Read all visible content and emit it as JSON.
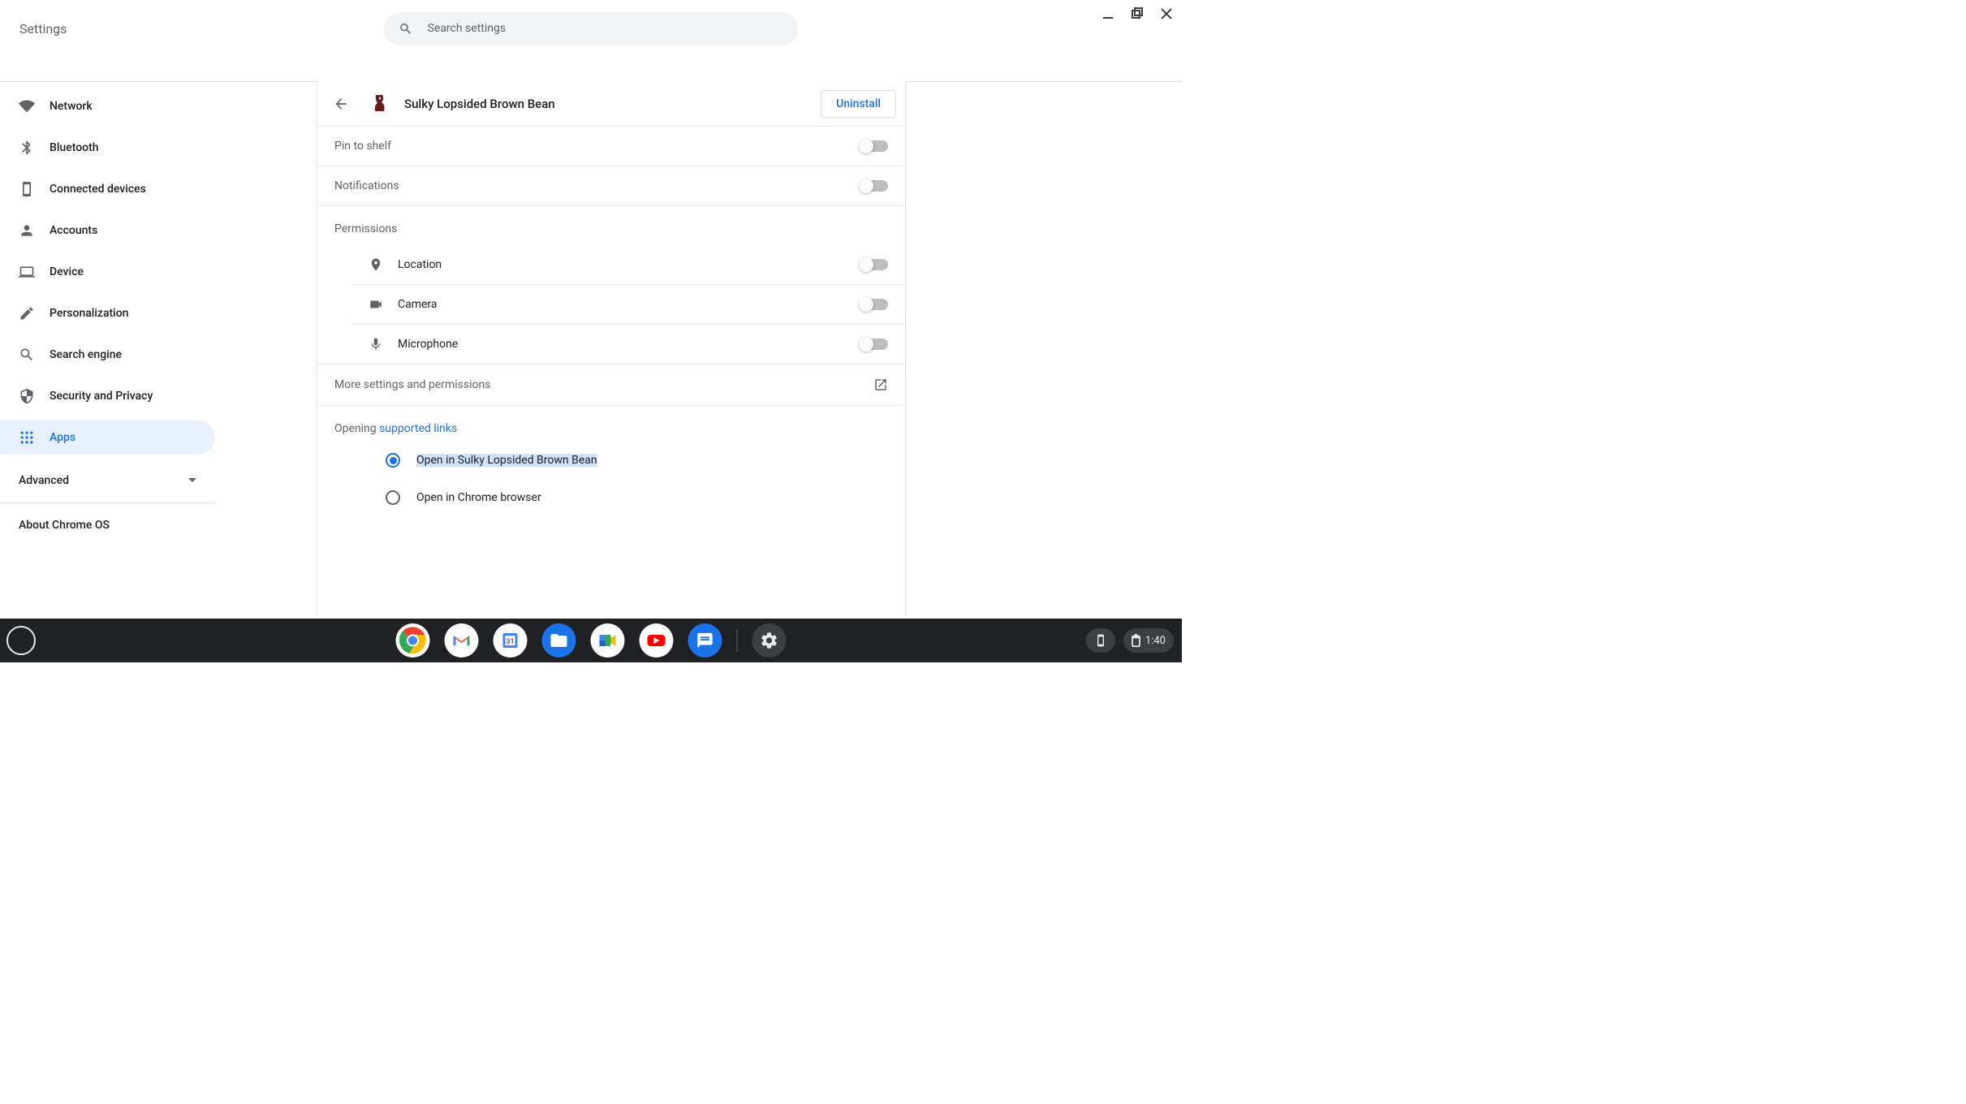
{
  "header": {
    "title": "Settings",
    "search_placeholder": "Search settings"
  },
  "sidebar": {
    "items": [
      {
        "label": "Network",
        "active": false
      },
      {
        "label": "Bluetooth",
        "active": false
      },
      {
        "label": "Connected devices",
        "active": false
      },
      {
        "label": "Accounts",
        "active": false
      },
      {
        "label": "Device",
        "active": false
      },
      {
        "label": "Personalization",
        "active": false
      },
      {
        "label": "Search engine",
        "active": false
      },
      {
        "label": "Security and Privacy",
        "active": false
      },
      {
        "label": "Apps",
        "active": true
      }
    ],
    "advanced": "Advanced",
    "about": "About Chrome OS"
  },
  "app_detail": {
    "name": "Sulky Lopsided Brown Bean",
    "uninstall": "Uninstall",
    "pin_to_shelf": "Pin to shelf",
    "notifications": "Notifications",
    "permissions_title": "Permissions",
    "permissions": {
      "location": "Location",
      "camera": "Camera",
      "microphone": "Microphone"
    },
    "more_settings": "More settings and permissions",
    "opening_prefix": "Opening ",
    "opening_link": "supported links",
    "radio_open_in_app": "Open in Sulky Lopsided Brown Bean",
    "radio_open_in_chrome": "Open in Chrome browser"
  },
  "shelf": {
    "time": "1:40"
  }
}
